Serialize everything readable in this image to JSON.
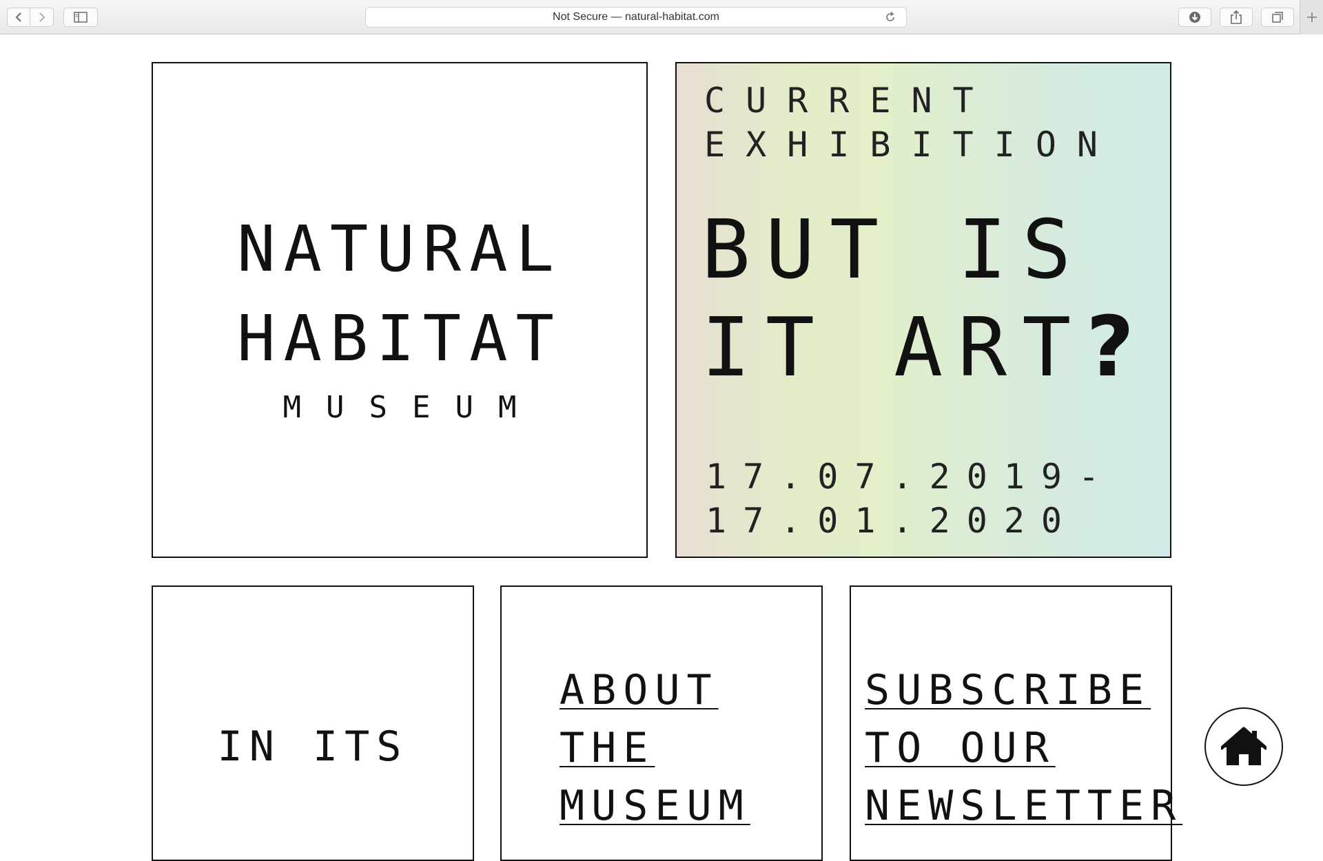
{
  "browser": {
    "address": "Not Secure — natural-habitat.com",
    "icons": [
      "back-icon",
      "forward-icon",
      "sidebar-icon",
      "reload-icon",
      "download-icon",
      "share-icon",
      "tabs-icon",
      "new-tab-icon"
    ]
  },
  "logo": {
    "line1": "NATURAL",
    "line2": "HABITAT",
    "line3": "MUSEUM"
  },
  "exhibition": {
    "label_line1": "CURRENT",
    "label_line2": "EXHIBITION",
    "title_line1": "BUT IS",
    "title_line2": "IT ART",
    "title_mark": "?",
    "date_line1": "17.07.2019-",
    "date_line2": "17.01.2020",
    "gradient_colors": [
      "#e8ddd3",
      "#e2efc9",
      "#d0ebe8"
    ]
  },
  "about": {
    "line1": "IN ITS"
  },
  "museum_link": {
    "line1": "ABOUT",
    "line2": "THE",
    "line3": "MUSEUM"
  },
  "subscribe_link": {
    "line1": "SUBSCRIBE",
    "line2": "TO OUR",
    "line3": "NEWSLETTER"
  },
  "home_button": {
    "icon": "home-icon"
  }
}
